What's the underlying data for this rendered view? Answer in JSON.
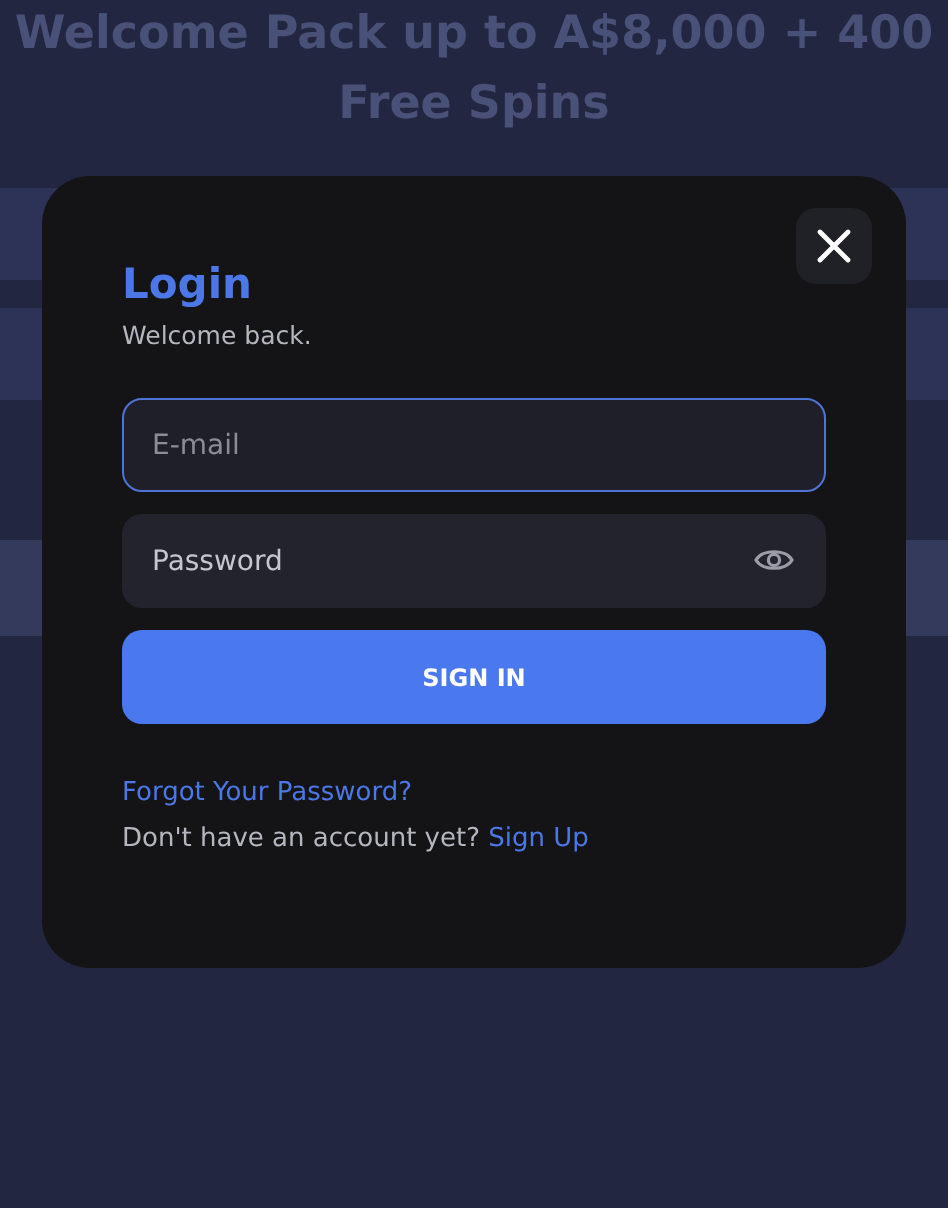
{
  "background": {
    "headline": "Welcome Pack up to A$8,000 + 400 Free Spins"
  },
  "dialog": {
    "title": "Login",
    "subtitle": "Welcome back.",
    "email_field": {
      "placeholder": "E-mail",
      "focused": true
    },
    "password_field": {
      "placeholder": "Password"
    },
    "sign_in_button": "SIGN IN",
    "forgot_link": "Forgot Your Password?",
    "signup_prompt": "Don't have an account yet?",
    "signup_link": "Sign Up"
  }
}
